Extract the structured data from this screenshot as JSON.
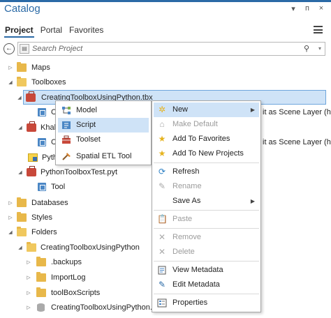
{
  "panel": {
    "title": "Catalog",
    "controls": {
      "menu": "▾",
      "pin": "ᴨ",
      "close": "×"
    }
  },
  "tabs": [
    "Project",
    "Portal",
    "Favorites"
  ],
  "search": {
    "placeholder": "Search Project"
  },
  "tree": {
    "maps": "Maps",
    "toolboxes": "Toolboxes",
    "tbx1": "CreatingToolboxUsingPython.tbx",
    "tbx1_child": "C",
    "tbx2": "Khal",
    "tbx2_child": "C",
    "pyt1": "Pytho",
    "pyt2": "PythonToolboxTest.pyt",
    "tool": "Tool",
    "databases": "Databases",
    "styles": "Styles",
    "folders": "Folders",
    "folder_main": "CreatingToolboxUsingPython",
    "backups": ".backups",
    "importlog": "ImportLog",
    "toolboxscripts": "toolBoxScripts",
    "gdb": "CreatingToolboxUsingPython.gd",
    "trail1": "it as Scene Layer (ho",
    "trail2": "it as Scene Layer (ho"
  },
  "menu_new": {
    "items": [
      "Model",
      "Script",
      "Toolset",
      "Spatial ETL Tool"
    ],
    "hover_index": 1
  },
  "context_menu": {
    "new": "New",
    "make_default": "Make Default",
    "add_favorites": "Add To Favorites",
    "add_new_projects": "Add To New Projects",
    "refresh": "Refresh",
    "rename": "Rename",
    "save_as": "Save As",
    "paste": "Paste",
    "remove": "Remove",
    "delete": "Delete",
    "view_metadata": "View Metadata",
    "edit_metadata": "Edit Metadata",
    "properties": "Properties"
  },
  "colors": {
    "accent": "#2b6aa6",
    "selection": "#cfe3f7",
    "star": "#e6b31e",
    "toolbox": "#c8483a",
    "folder": "#e8b84a"
  }
}
